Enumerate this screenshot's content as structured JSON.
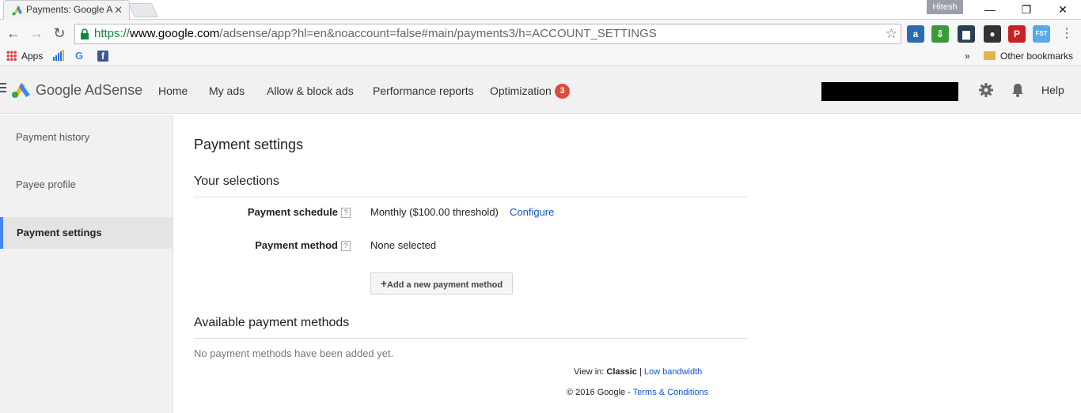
{
  "browser": {
    "tab_title": "Payments: Google A",
    "tab_close": "✕",
    "user_name": "Hitesh",
    "window_controls": {
      "minimize": "—",
      "maximize": "❐",
      "close": "✕"
    },
    "nav": {
      "back": "←",
      "forward": "→",
      "reload": "↻"
    },
    "url_scheme": "https://",
    "url_host": "www.google.com",
    "url_path": "/adsense/app?hl=en&noaccount=false#main/payments3/h=ACCOUNT_SETTINGS",
    "star": "☆",
    "menu": "⋮",
    "bookmarks": {
      "apps_label": "Apps",
      "google_glyph": "G",
      "facebook_glyph": "f",
      "overflow": "»",
      "other_bookmarks": "Other bookmarks"
    },
    "extensions": [
      {
        "name": "amazon-assistant-icon",
        "glyph": "a",
        "color": "#2b6cb0"
      },
      {
        "name": "download-extension-icon",
        "glyph": "⇩",
        "color": "#3a9a3a"
      },
      {
        "name": "wallet-extension-icon",
        "glyph": "▆",
        "color": "#2c3e50"
      },
      {
        "name": "ghostery-extension-icon",
        "glyph": "●",
        "color": "#333333"
      },
      {
        "name": "pinterest-icon",
        "glyph": "P",
        "color": "#cb2027"
      },
      {
        "name": "fst-extension-icon",
        "glyph": "FST",
        "color": "#5aa9e6"
      }
    ]
  },
  "app": {
    "brand": "Google AdSense",
    "nav": [
      "Home",
      "My ads",
      "Allow & block ads",
      "Performance reports",
      "Optimization"
    ],
    "optimization_badge": "3",
    "help": "Help",
    "accent_color": "#4285f4"
  },
  "sidebar": {
    "items": [
      {
        "label": "Payment history",
        "active": false
      },
      {
        "label": "Payee profile",
        "active": false
      },
      {
        "label": "Payment settings",
        "active": true
      }
    ]
  },
  "main": {
    "page_title": "Payment settings",
    "selections_title": "Your selections",
    "schedule_label": "Payment schedule",
    "schedule_value": "Monthly ($100.00 threshold)",
    "configure_link": "Configure",
    "method_label": "Payment method",
    "method_value": "None selected",
    "help_glyph": "?",
    "add_button": "Add a new payment method",
    "add_button_plus": "+",
    "available_title": "Available payment methods",
    "empty_message": "No payment methods have been added yet.",
    "footer": {
      "view_in": "View in:",
      "classic": "Classic",
      "separator": "|",
      "low_bandwidth": "Low bandwidth",
      "copyright": "© 2016 Google -",
      "terms": "Terms & Conditions"
    }
  }
}
